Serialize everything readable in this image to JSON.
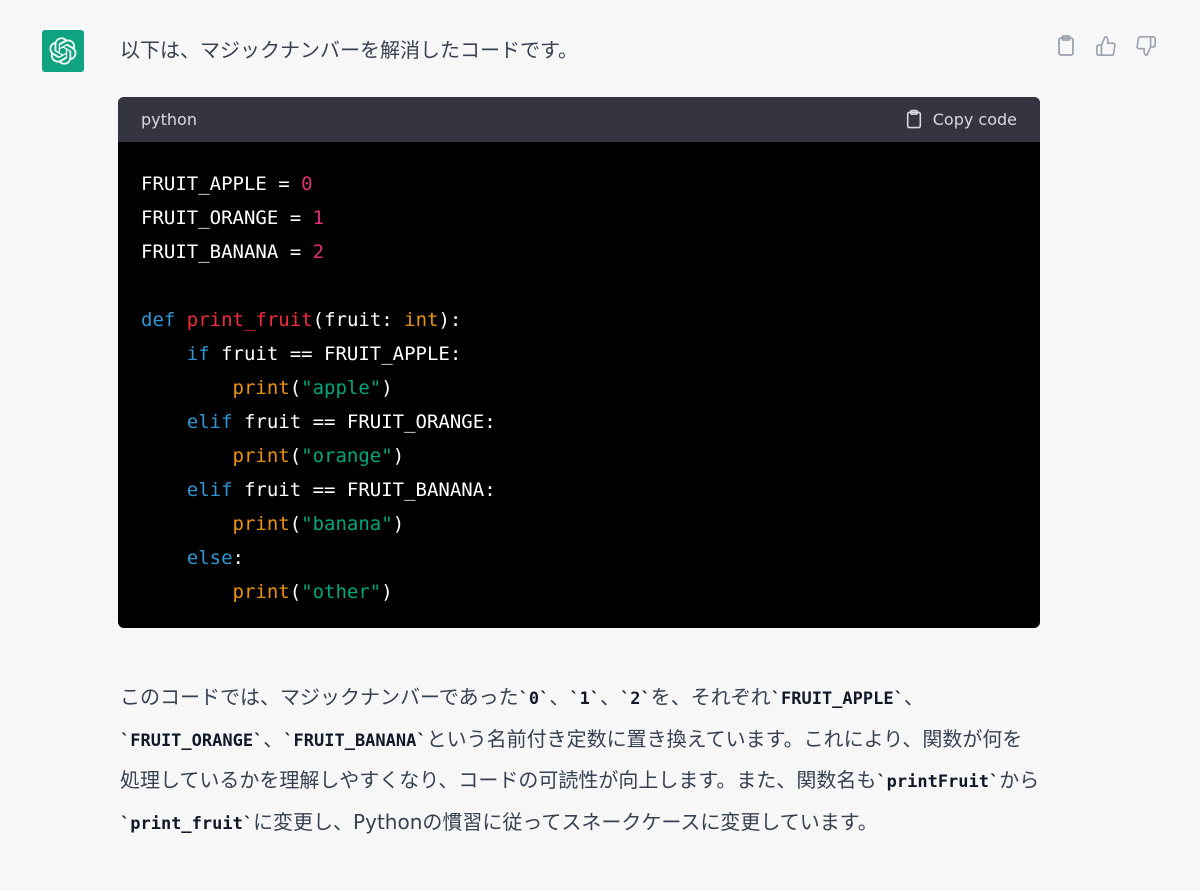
{
  "message": {
    "intro": "以下は、マジックナンバーを解消したコードです。"
  },
  "actions": [
    {
      "icon": "clipboard-icon"
    },
    {
      "icon": "thumbs-up-icon"
    },
    {
      "icon": "thumbs-down-icon"
    }
  ],
  "code_block": {
    "language": "python",
    "copy_label": "Copy code",
    "lines": [
      [
        [
          "plain",
          "FRUIT_APPLE = "
        ],
        [
          "num",
          "0"
        ]
      ],
      [
        [
          "plain",
          "FRUIT_ORANGE = "
        ],
        [
          "num",
          "1"
        ]
      ],
      [
        [
          "plain",
          "FRUIT_BANANA = "
        ],
        [
          "num",
          "2"
        ]
      ],
      [],
      [
        [
          "kw",
          "def"
        ],
        [
          "plain",
          " "
        ],
        [
          "fn",
          "print_fruit"
        ],
        [
          "plain",
          "(fruit: "
        ],
        [
          "bi",
          "int"
        ],
        [
          "plain",
          "):"
        ]
      ],
      [
        [
          "plain",
          "    "
        ],
        [
          "kw",
          "if"
        ],
        [
          "plain",
          " fruit == FRUIT_APPLE:"
        ]
      ],
      [
        [
          "plain",
          "        "
        ],
        [
          "bi",
          "print"
        ],
        [
          "plain",
          "("
        ],
        [
          "str",
          "\"apple\""
        ],
        [
          "plain",
          ")"
        ]
      ],
      [
        [
          "plain",
          "    "
        ],
        [
          "kw",
          "elif"
        ],
        [
          "plain",
          " fruit == FRUIT_ORANGE:"
        ]
      ],
      [
        [
          "plain",
          "        "
        ],
        [
          "bi",
          "print"
        ],
        [
          "plain",
          "("
        ],
        [
          "str",
          "\"orange\""
        ],
        [
          "plain",
          ")"
        ]
      ],
      [
        [
          "plain",
          "    "
        ],
        [
          "kw",
          "elif"
        ],
        [
          "plain",
          " fruit == FRUIT_BANANA:"
        ]
      ],
      [
        [
          "plain",
          "        "
        ],
        [
          "bi",
          "print"
        ],
        [
          "plain",
          "("
        ],
        [
          "str",
          "\"banana\""
        ],
        [
          "plain",
          ")"
        ]
      ],
      [
        [
          "plain",
          "    "
        ],
        [
          "kw",
          "else"
        ],
        [
          "plain",
          ":"
        ]
      ],
      [
        [
          "plain",
          "        "
        ],
        [
          "bi",
          "print"
        ],
        [
          "plain",
          "("
        ],
        [
          "str",
          "\"other\""
        ],
        [
          "plain",
          ")"
        ]
      ]
    ]
  },
  "explanation": {
    "segments": [
      [
        "t",
        "このコードでは、マジックナンバーであった"
      ],
      [
        "c",
        "`0`"
      ],
      [
        "t",
        "、"
      ],
      [
        "c",
        "`1`"
      ],
      [
        "t",
        "、"
      ],
      [
        "c",
        "`2`"
      ],
      [
        "t",
        "を、それぞれ"
      ],
      [
        "c",
        "`FRUIT_APPLE`"
      ],
      [
        "t",
        "、"
      ],
      [
        "c",
        "`FRUIT_ORANGE`"
      ],
      [
        "t",
        "、"
      ],
      [
        "c",
        "`FRUIT_BANANA`"
      ],
      [
        "t",
        "という名前付き定数に置き換えています。これにより、関数が何を処理しているかを理解しやすくなり、コードの可読性が向上します。また、関数名も"
      ],
      [
        "c",
        "`printFruit`"
      ],
      [
        "t",
        "から"
      ],
      [
        "c",
        "`print_fruit`"
      ],
      [
        "t",
        "に変更し、Pythonの慣習に従ってスネークケースに変更しています。"
      ]
    ]
  },
  "colors": {
    "avatar_bg": "#10a37f",
    "page_bg": "#f7f7f8",
    "code_bg": "#000000",
    "code_header_bg": "#343541",
    "keyword": "#2e95d3",
    "function": "#f22c3d",
    "number": "#df3079",
    "builtin": "#e9950c",
    "string": "#00a67d"
  }
}
